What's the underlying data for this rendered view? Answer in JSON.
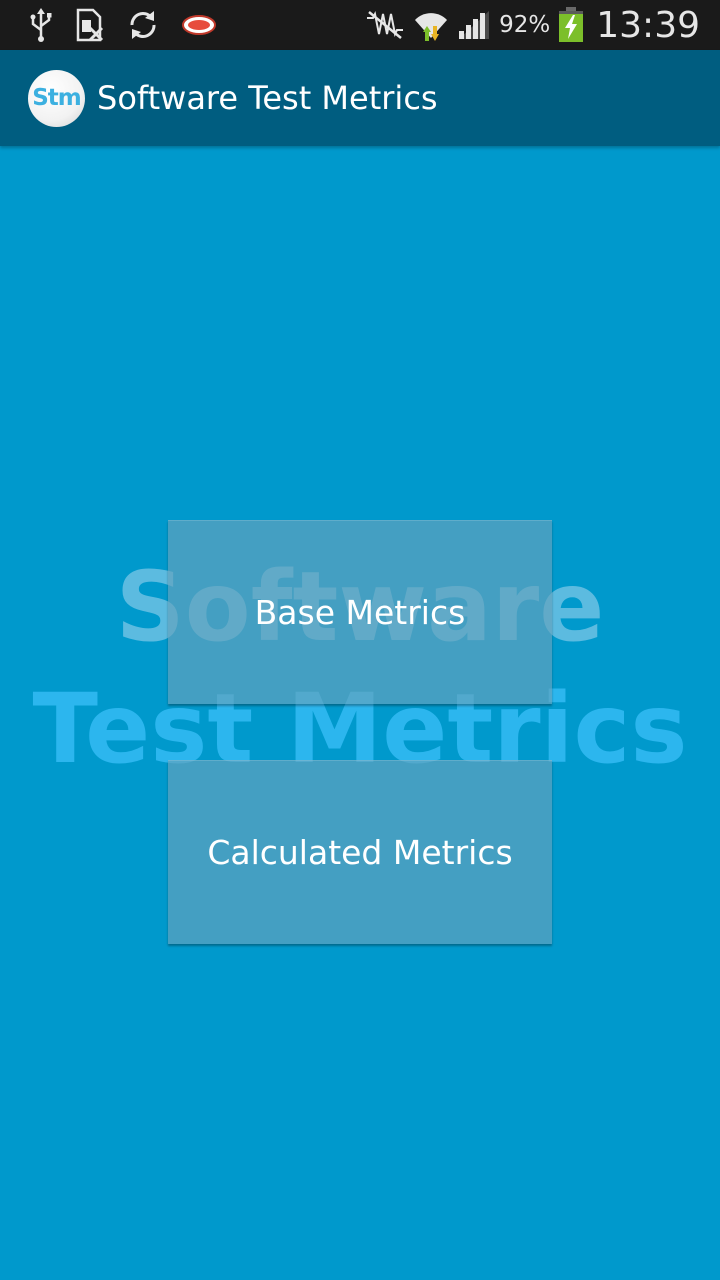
{
  "status_bar": {
    "icons_left": [
      "usb-icon",
      "sim-icon",
      "sync-icon",
      "app-notification-icon"
    ],
    "icons_right": [
      "no-signal-icon",
      "wifi-icon",
      "cell-signal-icon",
      "battery-charging-icon"
    ],
    "battery_percent": "92%",
    "time": "13:39"
  },
  "action_bar": {
    "logo_text": "Stm",
    "title": "Software Test Metrics"
  },
  "main": {
    "watermark_line1": "Software",
    "watermark_line2": "Test Metrics",
    "buttons": {
      "base_metrics": "Base Metrics",
      "calculated_metrics": "Calculated Metrics"
    }
  },
  "colors": {
    "background": "#0099cc",
    "action_bar": "#005d80",
    "status_bar": "#1a1a1a",
    "button": "#64a2bc",
    "logo_text": "#3cb0e0"
  }
}
